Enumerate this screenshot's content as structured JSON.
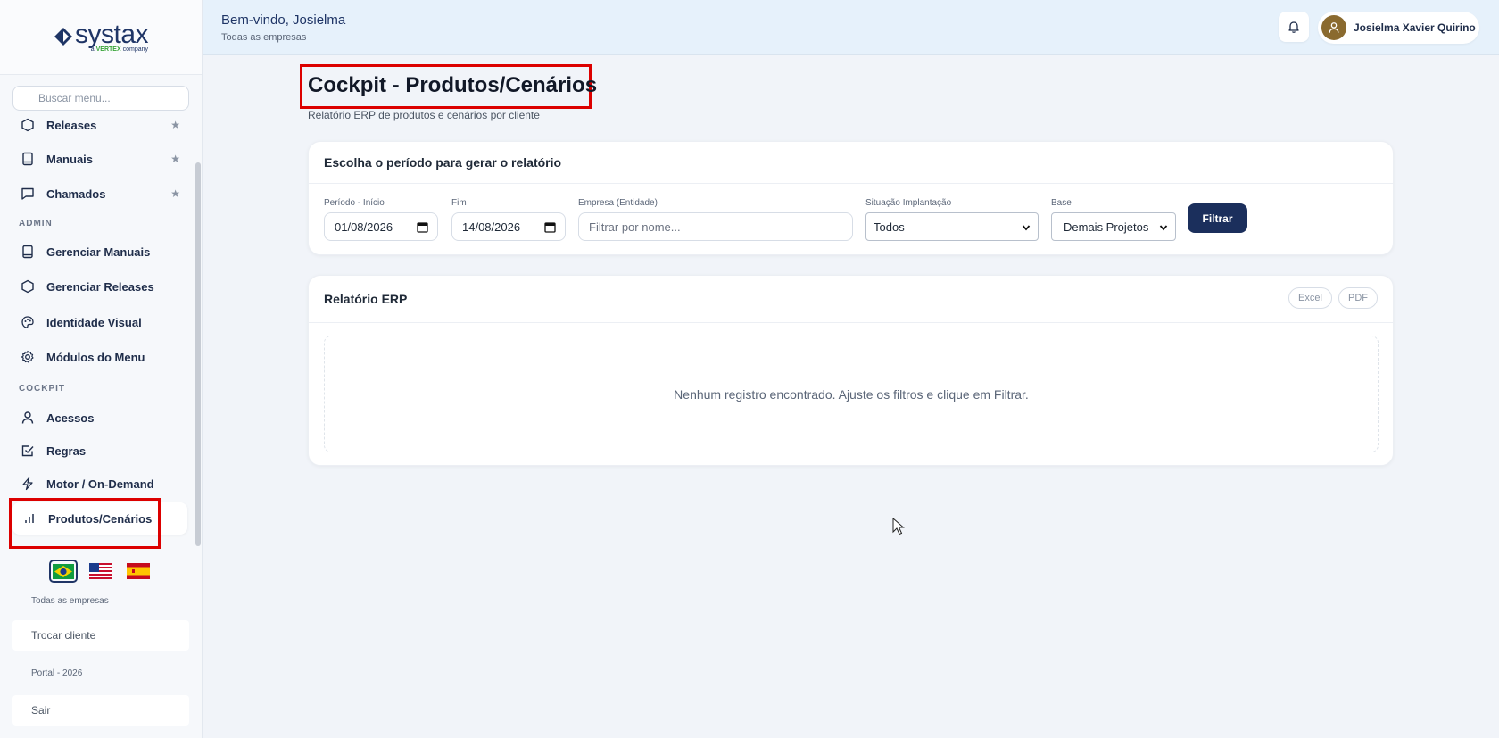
{
  "brand": {
    "name": "systax",
    "tagline_prefix": "a ",
    "tagline_brand": "VERTEX",
    "tagline_suffix": " company",
    "color": "#1f3566"
  },
  "sidebar": {
    "search_placeholder": "Buscar menu...",
    "items_top": [
      {
        "label": "Releases",
        "icon": "hexagon-icon",
        "starred": true
      },
      {
        "label": "Manuais",
        "icon": "book-icon",
        "starred": true
      },
      {
        "label": "Chamados",
        "icon": "chat-icon",
        "starred": true
      }
    ],
    "section_admin": "ADMIN",
    "items_admin": [
      {
        "label": "Gerenciar Manuais",
        "icon": "book-icon"
      },
      {
        "label": "Gerenciar Releases",
        "icon": "hexagon-icon"
      },
      {
        "label": "Identidade Visual",
        "icon": "palette-icon"
      },
      {
        "label": "Módulos do Menu",
        "icon": "gear-icon"
      }
    ],
    "section_cockpit": "COCKPIT",
    "items_cockpit": [
      {
        "label": "Acessos",
        "icon": "user-icon"
      },
      {
        "label": "Regras",
        "icon": "checkbox-icon"
      },
      {
        "label": "Motor / On-Demand",
        "icon": "lightning-icon"
      },
      {
        "label": "Produtos/Cenários",
        "icon": "bar-chart-icon",
        "active": true
      }
    ],
    "company_scope": "Todas as empresas",
    "switch_client": "Trocar cliente",
    "portal_version": "Portal - 2026",
    "logout": "Sair"
  },
  "header": {
    "welcome": "Bem-vindo, Josielma",
    "scope": "Todas as empresas",
    "user_name": "Josielma Xavier Quirino"
  },
  "page": {
    "title": "Cockpit - Produtos/Cenários",
    "subtitle": "Relatório ERP de produtos e cenários por cliente"
  },
  "filters": {
    "card_title": "Escolha o período para gerar o relatório",
    "start_label": "Período - Início",
    "start_value": "01/08/2026",
    "end_label": "Fim",
    "end_value": "14/08/2026",
    "company_label": "Empresa (Entidade)",
    "company_placeholder": "Filtrar por nome...",
    "status_label": "Situação Implantação",
    "status_value": "Todos",
    "base_label": "Base",
    "base_value": "Demais Projetos",
    "submit": "Filtrar"
  },
  "report": {
    "card_title": "Relatório ERP",
    "excel": "Excel",
    "pdf": "PDF",
    "empty_message": "Nenhum registro encontrado. Ajuste os filtros e clique em Filtrar."
  },
  "colors": {
    "accent": "#1b2f5c",
    "highlight": "#dc0000",
    "header_bg": "#e6f1fb"
  }
}
